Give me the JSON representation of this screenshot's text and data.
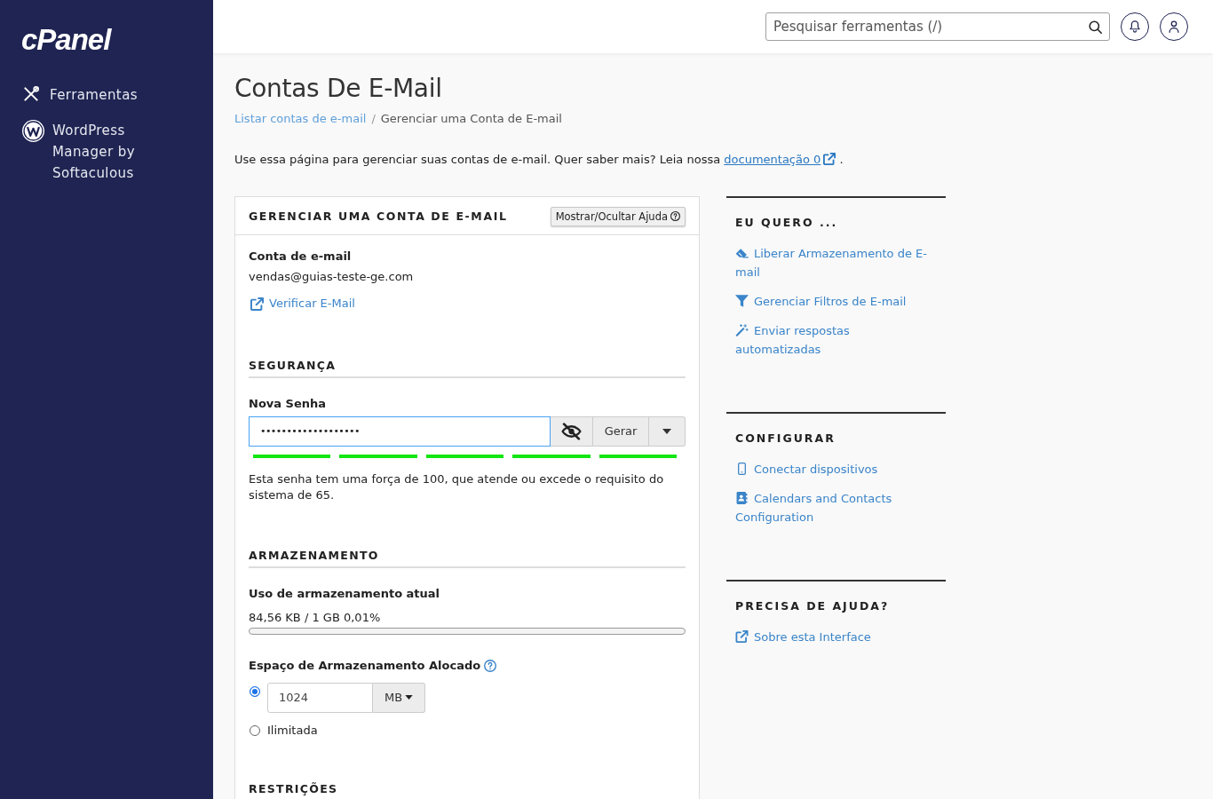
{
  "sidebar": {
    "logo": "cPanel",
    "items": [
      {
        "label": "Ferramentas"
      },
      {
        "label": "WordPress Manager by Softaculous"
      }
    ]
  },
  "header": {
    "search": {
      "placeholder": "Pesquisar ferramentas (/)"
    }
  },
  "page": {
    "title": "Contas De E-Mail",
    "breadcrumb": {
      "separator": "/",
      "items": [
        {
          "label": "Listar contas de e-mail",
          "current": false
        },
        {
          "label": "Gerenciar uma Conta de E-mail",
          "current": true
        }
      ]
    },
    "intro": {
      "text": "Use essa página para gerenciar suas contas de e-mail. Quer saber mais? Leia nossa",
      "link": "documentação 0",
      "end": "."
    }
  },
  "panel": {
    "title": "GERENCIAR UMA CONTA DE E-MAIL",
    "help_button": "Mostrar/Ocultar Ajuda",
    "account": {
      "label": "Conta de e-mail",
      "value": "vendas@guias-teste-ge.com",
      "link": "Verificar E-Mail"
    },
    "security": {
      "heading": "SEGURANÇA",
      "label": "Nova Senha",
      "value": "•••••••••••••••••••",
      "focused": true,
      "generate_button": "Gerar",
      "strength": {
        "level": 1,
        "text": "Esta senha tem uma força de 100, que atende ou excede o requisito do sistema de 65."
      }
    },
    "storage": {
      "heading": "ARMAZENAMENTO",
      "usage_label": "Uso de armazenamento atual",
      "usage_text": "84,56 KB / 1 GB 0,01%",
      "level": 0.0001,
      "quota_label": "Espaço de Armazenamento Alocado",
      "options": [
        {
          "kind": "amount",
          "selected": true,
          "value": "1024",
          "unit": "MB"
        },
        {
          "kind": "unlimited",
          "selected": false,
          "label": "Ilimitada"
        }
      ]
    },
    "restrictions": {
      "heading": "RESTRIÇÕES"
    }
  },
  "side": {
    "sections": [
      {
        "heading": "EU QUERO ...",
        "links": [
          "Liberar Armazenamento de E-mail",
          "Gerenciar Filtros de E-mail",
          "Enviar respostas automatizadas"
        ]
      },
      {
        "heading": "CONFIGURAR",
        "links": [
          "Conectar dispositivos",
          "Calendars and Contacts Configuration"
        ]
      },
      {
        "heading": "PRECISA DE AJUDA?",
        "links": [
          "Sobre esta Interface"
        ]
      }
    ]
  }
}
